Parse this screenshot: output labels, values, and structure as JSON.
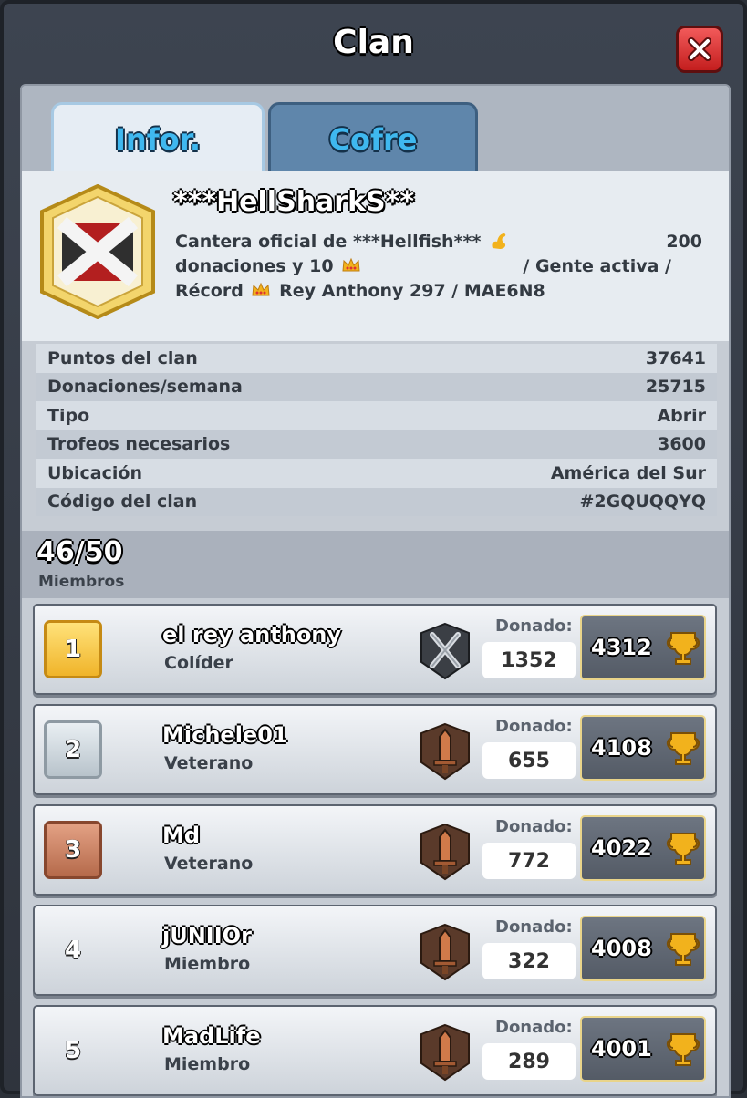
{
  "window": {
    "title": "Clan"
  },
  "tabs": [
    {
      "label": "Infor."
    },
    {
      "label": "Cofre"
    }
  ],
  "clan": {
    "name": "***HellSharkS**",
    "description_lines": [
      {
        "left": "Cantera oficial de ***Hellfish***",
        "right": "200"
      },
      {
        "left": "donaciones y 10",
        "right": "/ Gente activa /"
      },
      {
        "left": "Récord",
        "suffix": "Rey Anthony 297 / MAE6N8"
      }
    ]
  },
  "stats": [
    {
      "label": "Puntos del clan",
      "value": "37641"
    },
    {
      "label": "Donaciones/semana",
      "value": "25715"
    },
    {
      "label": "Tipo",
      "value": "Abrir"
    },
    {
      "label": "Trofeos necesarios",
      "value": "3600"
    },
    {
      "label": "Ubicación",
      "value": "América del Sur"
    },
    {
      "label": "Código del clan",
      "value": "#2GQUQQYQ"
    }
  ],
  "members_header": {
    "count": "46/50",
    "label": "Miembros"
  },
  "donated_label": "Donado:",
  "members": [
    {
      "rank": "1",
      "name": "el rey anthony",
      "role": "Colíder",
      "donated": "1352",
      "trophies": "4312",
      "rank_style": "gold",
      "role_icon": "coleader-swords-icon"
    },
    {
      "rank": "2",
      "name": "Michele01",
      "role": "Veterano",
      "donated": "655",
      "trophies": "4108",
      "rank_style": "silver",
      "role_icon": "elder-sword-icon"
    },
    {
      "rank": "3",
      "name": "Md",
      "role": "Veterano",
      "donated": "772",
      "trophies": "4022",
      "rank_style": "bronze",
      "role_icon": "elder-sword-icon"
    },
    {
      "rank": "4",
      "name": "jUNIIOr",
      "role": "Miembro",
      "donated": "322",
      "trophies": "4008",
      "rank_style": "plain",
      "role_icon": "member-sword-icon"
    },
    {
      "rank": "5",
      "name": "MadLife",
      "role": "Miembro",
      "donated": "289",
      "trophies": "4001",
      "rank_style": "plain",
      "role_icon": "member-sword-icon"
    }
  ],
  "colors": {
    "tab_text": "#3fb8ef",
    "close_button": "#d62c2c",
    "trophy_gold": "#f2b21c"
  }
}
